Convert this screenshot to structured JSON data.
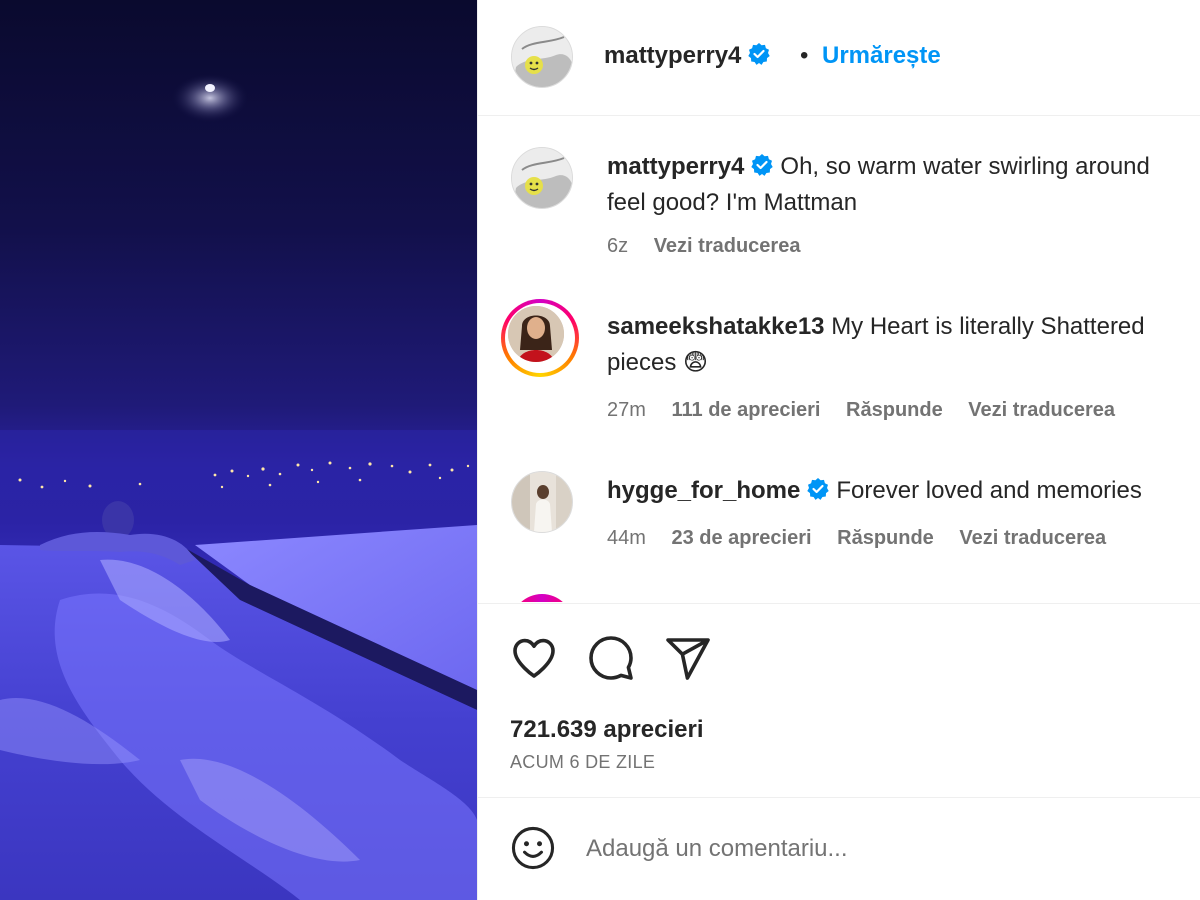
{
  "post": {
    "username": "mattyperry4",
    "follow_label": "Urmărește",
    "separator": "•"
  },
  "caption": {
    "username": "mattyperry4",
    "text_line1": "Oh, so warm water swirling around",
    "text_line2": "feel good? I'm Mattman",
    "time": "6z",
    "translate": "Vezi traducerea"
  },
  "comments": [
    {
      "username": "sameekshatakke13",
      "text_line1": "My Heart is literally Shattered",
      "text_line2": "pieces 😨",
      "time": "27m",
      "likes": "111 de aprecieri",
      "reply": "Răspunde",
      "translate": "Vezi traducerea"
    },
    {
      "username": "hygge_for_home",
      "text_line1": "Forever loved and memories",
      "time": "44m",
      "likes": "23 de aprecieri",
      "reply": "Răspunde",
      "translate": "Vezi traducerea"
    }
  ],
  "stats": {
    "likes": "721.639 aprecieri",
    "date": "ACUM 6 DE ZILE"
  },
  "composer": {
    "placeholder": "Adaugă un comentariu..."
  },
  "icons": {
    "like": "heart-icon",
    "comment": "comment-icon",
    "share": "share-icon",
    "emoji": "emoji-icon",
    "verified": "verified-badge-icon"
  },
  "colors": {
    "accent": "#0095f6",
    "verified": "#0095f6",
    "text": "#262626",
    "muted": "#737373"
  }
}
